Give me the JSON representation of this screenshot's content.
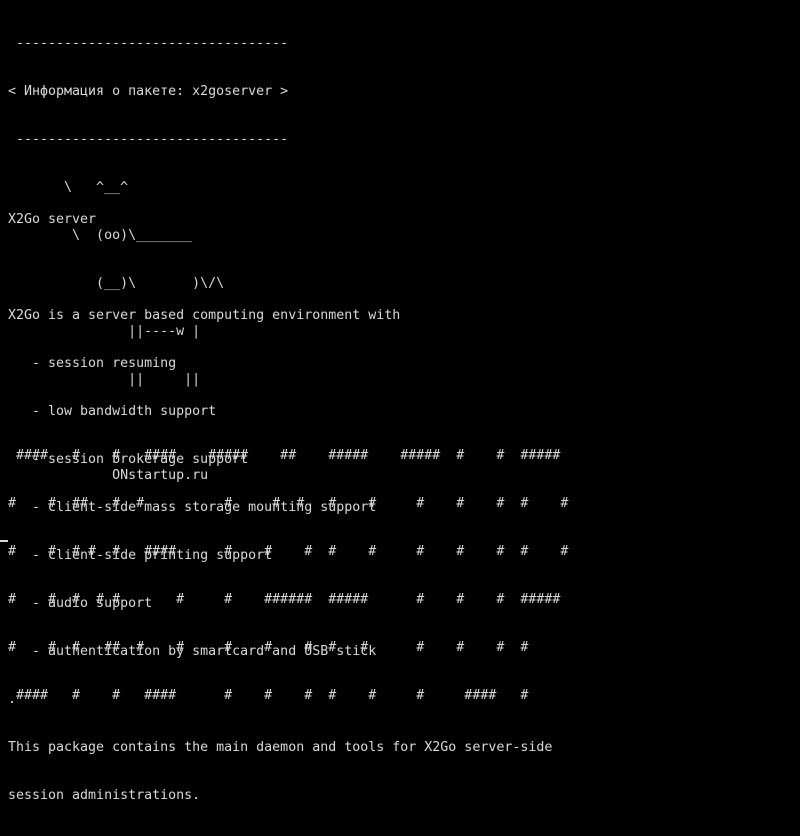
{
  "colors": {
    "background": "#000000",
    "foreground": "#d8d8d8"
  },
  "cowsay": {
    "lines": [
      " ----------------------------------",
      "< Информация о пакете: x2goserver >",
      " ----------------------------------",
      "       \\   ^__^",
      "        \\  (oo)\\_______",
      "           (__)\\       )\\/\\",
      "               ||----w |",
      "               ||     ||",
      "",
      "             ONstartup.ru"
    ]
  },
  "package_info": {
    "title": "X2Go server",
    "intro": "X2Go is a server based computing environment with",
    "features": [
      "   - session resuming",
      "   - low bandwidth support",
      "   - session brokerage support",
      "   - client-side mass storage mounting support",
      "   - client-side printing support",
      "   - audio support",
      "   - authentication by smartcard and USB stick"
    ],
    "separator": ".",
    "description_lines": [
      "This package contains the main daemon and tools for X2Go server-side",
      "session administrations."
    ]
  },
  "banner": {
    "lines": [
      " ####   #    #   ####    #####    ##    #####    #####  #    #  #####",
      "#    #  ##   #  #          #     #  #   #    #     #    #    #  #    #",
      "#    #  # #  #   ####      #    #    #  #    #     #    #    #  #    #",
      "#    #  #  # #       #     #    ######  #####      #    #    #  #####",
      "#    #  #   ##  #    #     #    #    #  #   #      #    #    #  #",
      " ####   #    #   ####      #    #    #  #    #     #     ####   #"
    ]
  }
}
